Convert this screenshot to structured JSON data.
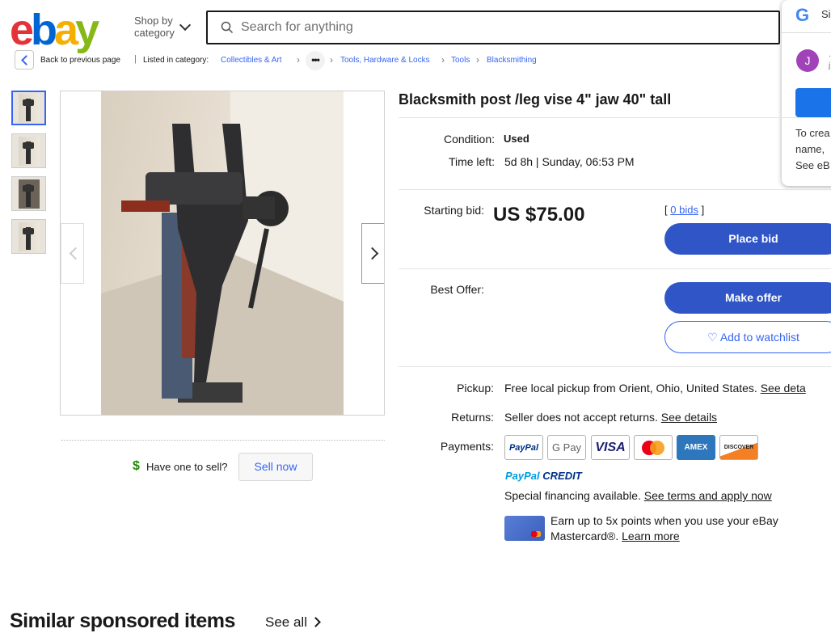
{
  "header": {
    "logo": [
      "e",
      "b",
      "a",
      "y"
    ],
    "shop_by": "Shop by",
    "category": "category",
    "search_placeholder": "Search for anything"
  },
  "google_popup": {
    "logo": "G",
    "title": "Si",
    "avatar_letter": "J",
    "account_line1": "·",
    "account_line2": "j",
    "line1": "To crea",
    "line2": "name,",
    "line3": "See eB"
  },
  "breadcrumb": {
    "back": "Back to previous page",
    "sep": "|",
    "listed": "Listed in category:",
    "items": [
      "Collectibles & Art",
      "Tools, Hardware & Locks",
      "Tools",
      "Blacksmithing"
    ],
    "more": "•••"
  },
  "listing": {
    "title": "Blacksmith post /leg vise 4\" jaw 40\" tall",
    "condition_label": "Condition:",
    "condition_value": "Used",
    "time_left_label": "Time left:",
    "time_left_value": "5d 8h | Sunday, 06:53 PM",
    "starting_bid_label": "Starting bid:",
    "price": "US $75.00",
    "bids_open": "[",
    "bids_link": "0 bids",
    "bids_close": "]",
    "place_bid": "Place bid",
    "best_offer_label": "Best Offer:",
    "make_offer": "Make offer",
    "watchlist": "Add to watchlist",
    "pickup_label": "Pickup:",
    "pickup_value": "Free local pickup from Orient, Ohio, United States.",
    "pickup_link": "See deta",
    "returns_label": "Returns:",
    "returns_value": "Seller does not accept returns.",
    "returns_link": "See details",
    "payments_label": "Payments:",
    "payment_methods": [
      "PayPal",
      "G Pay",
      "VISA",
      "",
      "AMEX",
      "DISCOVER"
    ],
    "paypal_credit_a": "PayPal",
    "paypal_credit_b": "CREDIT",
    "financing_text": "Special financing available.",
    "financing_link": "See terms and apply now",
    "card_line1": "Earn up to 5x points when you use your eBay",
    "card_line2": "Mastercard®.",
    "card_link": "Learn more"
  },
  "sell": {
    "icon": "$",
    "label": "Have one to sell?",
    "button": "Sell now"
  },
  "similar": {
    "heading": "Similar sponsored items",
    "see_all": "See all"
  },
  "colors": {
    "ebay_red": "#e53238",
    "ebay_blue": "#0064d2",
    "ebay_yellow": "#f5af02",
    "ebay_green": "#86b817",
    "button_blue": "#2f55c6",
    "link_blue": "#3665f3"
  }
}
